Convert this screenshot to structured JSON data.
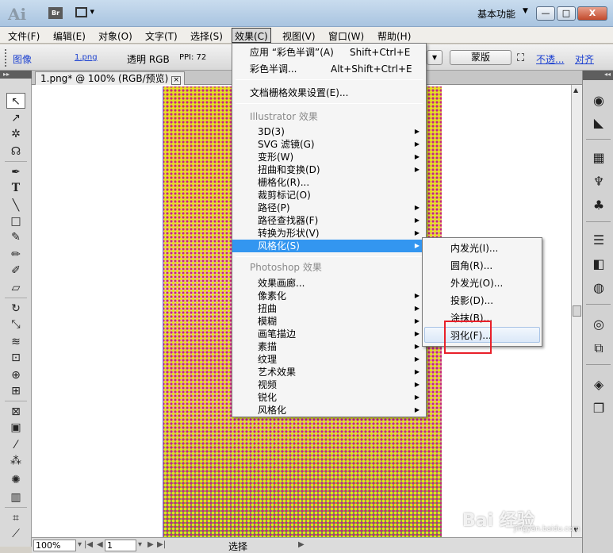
{
  "titlebar": {
    "logo": "Ai",
    "bridge": "Br",
    "workspace": "基本功能",
    "minimize": "—",
    "maximize": "□",
    "close": "X"
  },
  "menubar": {
    "items": [
      "文件(F)",
      "编辑(E)",
      "对象(O)",
      "文字(T)",
      "选择(S)",
      "效果(C)",
      "视图(V)",
      "窗口(W)",
      "帮助(H)"
    ],
    "active": "效果(C)"
  },
  "control_bar": {
    "image_label": "图像",
    "file_link": "1.png",
    "mode": "透明 RGB",
    "ppi": "PPI: 72",
    "mask_button": "蒙版",
    "opacity_link": "不透...",
    "align_link": "对齐"
  },
  "document": {
    "tab_title": "1.png* @ 100% (RGB/预览)",
    "zoom": "100%",
    "page": "1",
    "status_label": "选择"
  },
  "effect_menu": {
    "items": [
      {
        "label": "应用 “彩色半调”(A)",
        "shortcut": "Shift+Ctrl+E"
      },
      {
        "label": "彩色半调...",
        "shortcut": "Alt+Shift+Ctrl+E"
      },
      {
        "label": "文档栅格效果设置(E)..."
      },
      {
        "label": "Illustrator 效果"
      },
      {
        "label": "3D(3)"
      },
      {
        "label": "SVG 滤镜(G)"
      },
      {
        "label": "变形(W)"
      },
      {
        "label": "扭曲和变换(D)"
      },
      {
        "label": "栅格化(R)..."
      },
      {
        "label": "裁剪标记(O)"
      },
      {
        "label": "路径(P)"
      },
      {
        "label": "路径查找器(F)"
      },
      {
        "label": "转换为形状(V)"
      },
      {
        "label": "风格化(S)"
      },
      {
        "label": "Photoshop 效果"
      },
      {
        "label": "效果画廊..."
      },
      {
        "label": "像素化"
      },
      {
        "label": "扭曲"
      },
      {
        "label": "模糊"
      },
      {
        "label": "画笔描边"
      },
      {
        "label": "素描"
      },
      {
        "label": "纹理"
      },
      {
        "label": "艺术效果"
      },
      {
        "label": "视频"
      },
      {
        "label": "锐化"
      },
      {
        "label": "风格化"
      }
    ]
  },
  "stylize_submenu": {
    "items": [
      "内发光(I)...",
      "圆角(R)...",
      "外发光(O)...",
      "投影(D)...",
      "涂抹(B)...",
      "羽化(F)..."
    ]
  },
  "watermark": {
    "brand": "Bai 经验",
    "url": "jingyan.baidu.com"
  },
  "colors": {
    "highlight": "#3396f0",
    "callout": "#e8202a"
  }
}
